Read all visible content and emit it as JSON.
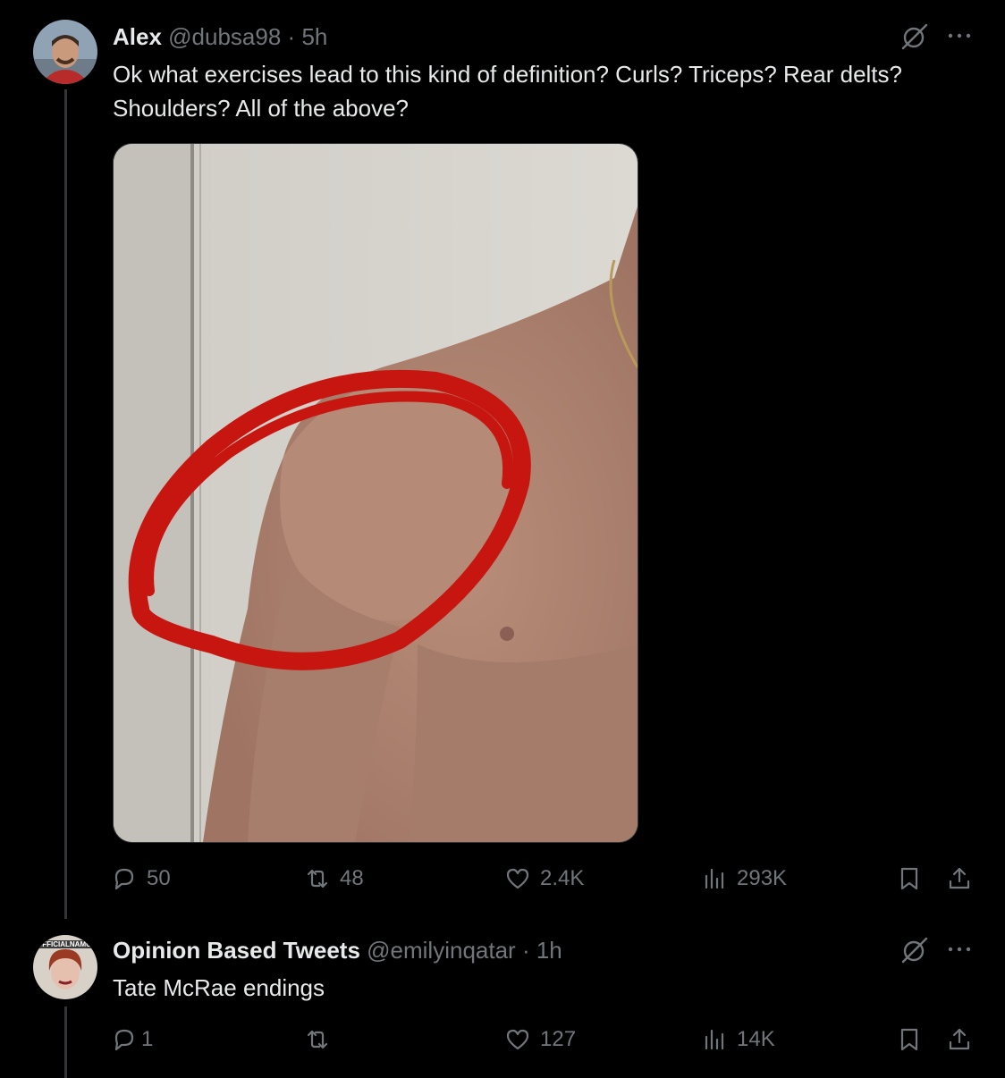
{
  "tweets": [
    {
      "name": "Alex",
      "handle": "@dubsa98",
      "separator": "·",
      "time": "5h",
      "text": "Ok what exercises lead to this kind of definition? Curls? Triceps? Rear delts? Shoulders? All of the above?",
      "actions": {
        "replies": "50",
        "reposts": "48",
        "likes": "2.4K",
        "views": "293K"
      }
    },
    {
      "name": "Opinion Based Tweets",
      "handle": "@emilyinqatar",
      "separator": "·",
      "time": "1h",
      "text": "Tate McRae endings",
      "avatar_badge": "OFFICIALNAMOUR",
      "actions": {
        "replies": "1",
        "reposts": "",
        "likes": "127",
        "views": "14K"
      }
    }
  ],
  "icons": [
    "grok-icon",
    "more-icon",
    "reply-icon",
    "repost-icon",
    "like-icon",
    "views-icon",
    "bookmark-icon",
    "share-icon"
  ],
  "colors": {
    "background": "#000000",
    "text": "#e7e9ea",
    "muted": "#71767b",
    "line": "#333639",
    "annotation": "#c7150f"
  }
}
